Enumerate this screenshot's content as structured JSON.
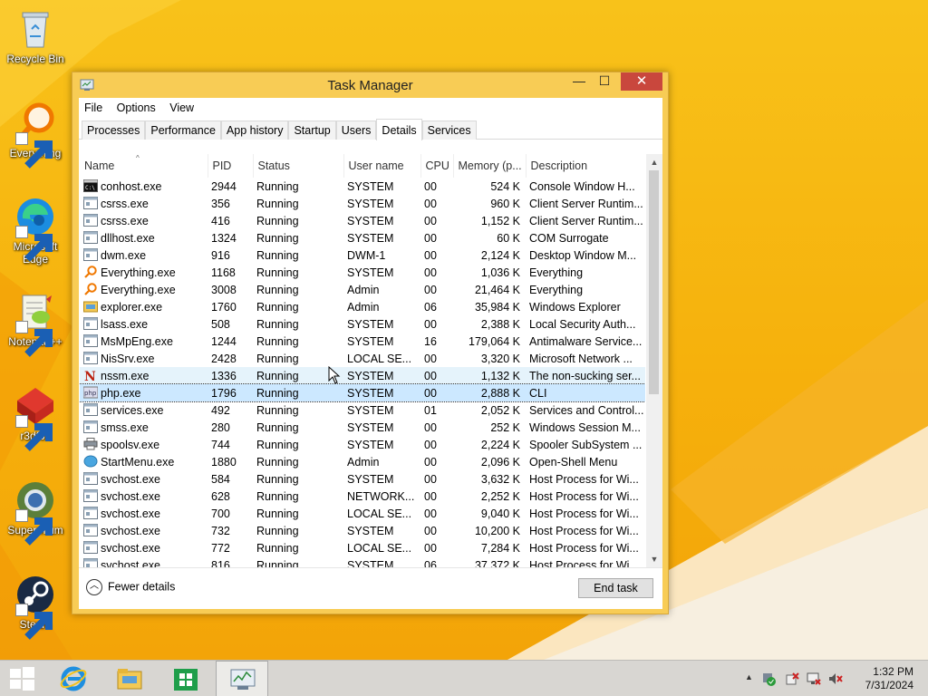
{
  "desktop": {
    "icons": [
      {
        "label": "Recycle Bin"
      },
      {
        "label": "Everything"
      },
      {
        "label": "Microsoft Edge"
      },
      {
        "label": "Notepad++"
      },
      {
        "label": "r3dfox"
      },
      {
        "label": "Supermium"
      },
      {
        "label": "Steam"
      }
    ]
  },
  "window": {
    "title": "Task Manager",
    "buttons": {
      "minimize": "—",
      "maximize": "☐",
      "close": "✕"
    },
    "menu": [
      "File",
      "Options",
      "View"
    ],
    "tabs": [
      {
        "label": "Processes"
      },
      {
        "label": "Performance"
      },
      {
        "label": "App history"
      },
      {
        "label": "Startup"
      },
      {
        "label": "Users"
      },
      {
        "label": "Details",
        "active": true
      },
      {
        "label": "Services"
      }
    ],
    "columns": [
      "Name",
      "PID",
      "Status",
      "User name",
      "CPU",
      "Memory (p...",
      "Description"
    ],
    "rows": [
      {
        "icon": "console-icon",
        "name": "conhost.exe",
        "pid": "2944",
        "status": "Running",
        "user": "SYSTEM",
        "cpu": "00",
        "mem": "524 K",
        "desc": "Console Window H..."
      },
      {
        "icon": "process-icon",
        "name": "csrss.exe",
        "pid": "356",
        "status": "Running",
        "user": "SYSTEM",
        "cpu": "00",
        "mem": "960 K",
        "desc": "Client Server Runtim..."
      },
      {
        "icon": "process-icon",
        "name": "csrss.exe",
        "pid": "416",
        "status": "Running",
        "user": "SYSTEM",
        "cpu": "00",
        "mem": "1,152 K",
        "desc": "Client Server Runtim..."
      },
      {
        "icon": "process-icon",
        "name": "dllhost.exe",
        "pid": "1324",
        "status": "Running",
        "user": "SYSTEM",
        "cpu": "00",
        "mem": "60 K",
        "desc": "COM Surrogate"
      },
      {
        "icon": "process-icon",
        "name": "dwm.exe",
        "pid": "916",
        "status": "Running",
        "user": "DWM-1",
        "cpu": "00",
        "mem": "2,124 K",
        "desc": "Desktop Window M..."
      },
      {
        "icon": "everything-icon",
        "name": "Everything.exe",
        "pid": "1168",
        "status": "Running",
        "user": "SYSTEM",
        "cpu": "00",
        "mem": "1,036 K",
        "desc": "Everything"
      },
      {
        "icon": "everything-icon",
        "name": "Everything.exe",
        "pid": "3008",
        "status": "Running",
        "user": "Admin",
        "cpu": "00",
        "mem": "21,464 K",
        "desc": "Everything"
      },
      {
        "icon": "explorer-icon",
        "name": "explorer.exe",
        "pid": "1760",
        "status": "Running",
        "user": "Admin",
        "cpu": "06",
        "mem": "35,984 K",
        "desc": "Windows Explorer"
      },
      {
        "icon": "process-icon",
        "name": "lsass.exe",
        "pid": "508",
        "status": "Running",
        "user": "SYSTEM",
        "cpu": "00",
        "mem": "2,388 K",
        "desc": "Local Security Auth..."
      },
      {
        "icon": "process-icon",
        "name": "MsMpEng.exe",
        "pid": "1244",
        "status": "Running",
        "user": "SYSTEM",
        "cpu": "16",
        "mem": "179,064 K",
        "desc": "Antimalware Service..."
      },
      {
        "icon": "process-icon",
        "name": "NisSrv.exe",
        "pid": "2428",
        "status": "Running",
        "user": "LOCAL SE...",
        "cpu": "00",
        "mem": "3,320 K",
        "desc": "Microsoft Network ..."
      },
      {
        "icon": "nssm-icon",
        "name": "nssm.exe",
        "pid": "1336",
        "status": "Running",
        "user": "SYSTEM",
        "cpu": "00",
        "mem": "1,132 K",
        "desc": "The non-sucking ser...",
        "state": "hover"
      },
      {
        "icon": "php-icon",
        "name": "php.exe",
        "pid": "1796",
        "status": "Running",
        "user": "SYSTEM",
        "cpu": "00",
        "mem": "2,888 K",
        "desc": "CLI",
        "state": "selected"
      },
      {
        "icon": "process-icon",
        "name": "services.exe",
        "pid": "492",
        "status": "Running",
        "user": "SYSTEM",
        "cpu": "01",
        "mem": "2,052 K",
        "desc": "Services and Control..."
      },
      {
        "icon": "process-icon",
        "name": "smss.exe",
        "pid": "280",
        "status": "Running",
        "user": "SYSTEM",
        "cpu": "00",
        "mem": "252 K",
        "desc": "Windows Session M..."
      },
      {
        "icon": "printer-icon",
        "name": "spoolsv.exe",
        "pid": "744",
        "status": "Running",
        "user": "SYSTEM",
        "cpu": "00",
        "mem": "2,224 K",
        "desc": "Spooler SubSystem ..."
      },
      {
        "icon": "startmenu-icon",
        "name": "StartMenu.exe",
        "pid": "1880",
        "status": "Running",
        "user": "Admin",
        "cpu": "00",
        "mem": "2,096 K",
        "desc": "Open-Shell Menu"
      },
      {
        "icon": "process-icon",
        "name": "svchost.exe",
        "pid": "584",
        "status": "Running",
        "user": "SYSTEM",
        "cpu": "00",
        "mem": "3,632 K",
        "desc": "Host Process for Wi..."
      },
      {
        "icon": "process-icon",
        "name": "svchost.exe",
        "pid": "628",
        "status": "Running",
        "user": "NETWORK...",
        "cpu": "00",
        "mem": "2,252 K",
        "desc": "Host Process for Wi..."
      },
      {
        "icon": "process-icon",
        "name": "svchost.exe",
        "pid": "700",
        "status": "Running",
        "user": "LOCAL SE...",
        "cpu": "00",
        "mem": "9,040 K",
        "desc": "Host Process for Wi..."
      },
      {
        "icon": "process-icon",
        "name": "svchost.exe",
        "pid": "732",
        "status": "Running",
        "user": "SYSTEM",
        "cpu": "00",
        "mem": "10,200 K",
        "desc": "Host Process for Wi..."
      },
      {
        "icon": "process-icon",
        "name": "svchost.exe",
        "pid": "772",
        "status": "Running",
        "user": "LOCAL SE...",
        "cpu": "00",
        "mem": "7,284 K",
        "desc": "Host Process for Wi..."
      },
      {
        "icon": "process-icon",
        "name": "svchost.exe",
        "pid": "816",
        "status": "Running",
        "user": "SYSTEM",
        "cpu": "06",
        "mem": "37,372 K",
        "desc": "Host Process for Wi..."
      }
    ],
    "footer": {
      "fewer_details": "Fewer details",
      "end_task": "End task"
    }
  },
  "taskbar": {
    "clock_time": "1:32 PM",
    "clock_date": "7/31/2024",
    "tray_chevron": "▲"
  },
  "colors": {
    "desktop": "#f6b10c",
    "window_frame": "#f8cc55",
    "close": "#c9473d",
    "selection": "#cce8ff",
    "hover": "#e5f3fb"
  }
}
